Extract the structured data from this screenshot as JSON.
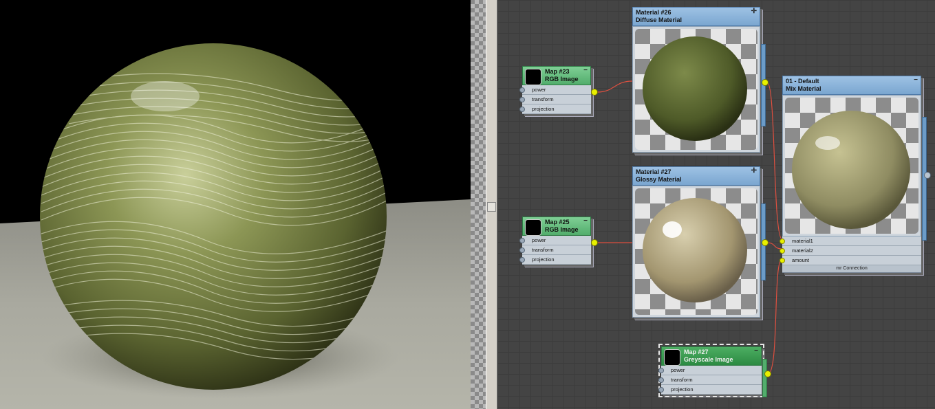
{
  "nodes": {
    "map23": {
      "title": "Map #23",
      "type": "RGB Image",
      "slots": [
        "power",
        "transform",
        "projection"
      ]
    },
    "map25": {
      "title": "Map #25",
      "type": "RGB Image",
      "slots": [
        "power",
        "transform",
        "projection"
      ]
    },
    "map27": {
      "title": "Map #27",
      "type": "Greyscale Image",
      "slots": [
        "power",
        "transform",
        "projection"
      ]
    },
    "mat26": {
      "title": "Material #26",
      "type": "Diffuse Material"
    },
    "mat27": {
      "title": "Material #27",
      "type": "Glossy Material"
    },
    "mix": {
      "title": "01 - Default",
      "type": "Mix Material",
      "slots": [
        "material1",
        "material2",
        "amount"
      ],
      "footer": "mr Connection"
    }
  },
  "icons": {
    "collapse": "minus-icon",
    "expand": "plus-icon"
  },
  "colors": {
    "socket": "#e8f000",
    "wire": "#e05040",
    "material_header": "#8bb4dc",
    "map_header": "#5fba78"
  }
}
